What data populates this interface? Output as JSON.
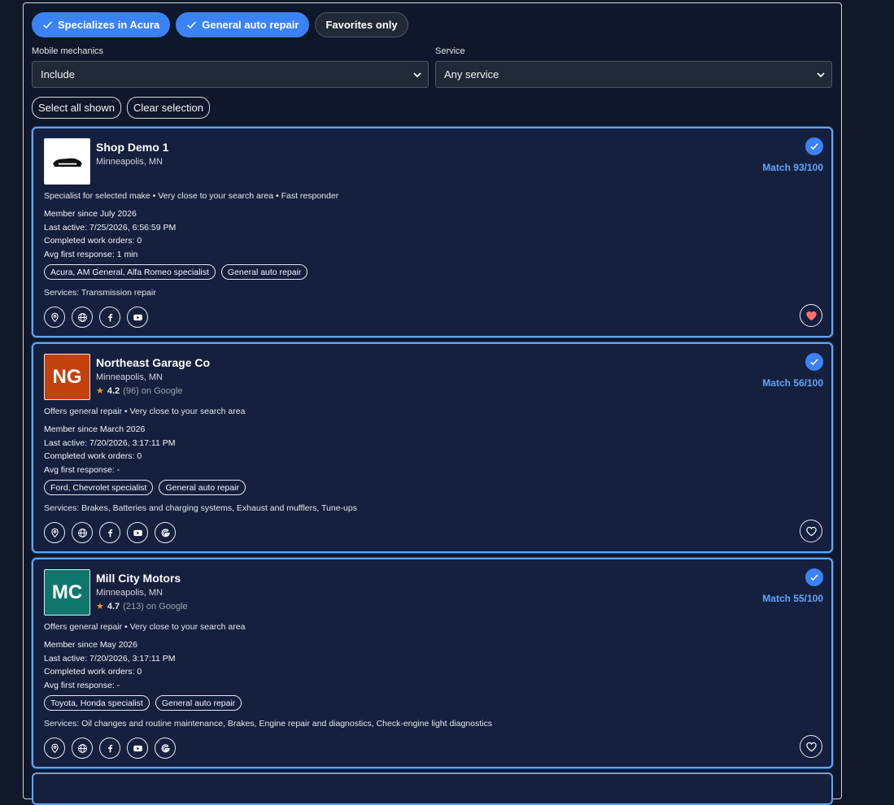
{
  "filters": {
    "chips": [
      {
        "label": "Specializes in Acura",
        "active": true
      },
      {
        "label": "General auto repair",
        "active": true
      },
      {
        "label": "Favorites only",
        "active": false
      }
    ],
    "mobile": {
      "label": "Mobile mechanics",
      "value": "Include"
    },
    "service": {
      "label": "Service",
      "value": "Any service"
    }
  },
  "actions": {
    "select_all": "Select all shown",
    "clear": "Clear selection"
  },
  "shops": [
    {
      "name": "Shop Demo 1",
      "location": "Minneapolis, MN",
      "logo_type": "image",
      "initials": "",
      "logo_color": "#ffffff",
      "match": "Match 93/100",
      "reasons": "Specialist for selected make • Very close to your search area • Fast responder",
      "member_since": "Member since July 2026",
      "last_active": "Last active: 7/25/2026, 6:56:59 PM",
      "work_orders": "Completed work orders: 0",
      "first_response": "Avg first response: 1 min",
      "tags": [
        "Acura, AM General, Alfa Romeo specialist",
        "General auto repair"
      ],
      "services": "Services: Transmission repair",
      "favorite": true
    },
    {
      "name": "Northeast Garage Co",
      "location": "Minneapolis, MN",
      "logo_type": "initials",
      "initials": "NG",
      "logo_color": "#c2410c",
      "rating": "4.2",
      "reviews": "(96) on Google",
      "match": "Match 56/100",
      "reasons": "Offers general repair • Very close to your search area",
      "member_since": "Member since March 2026",
      "last_active": "Last active: 7/20/2026, 3:17:11 PM",
      "work_orders": "Completed work orders: 0",
      "first_response": "Avg first response: -",
      "tags": [
        "Ford, Chevrolet specialist",
        "General auto repair"
      ],
      "services": "Services: Brakes, Batteries and charging systems, Exhaust and mufflers, Tune-ups",
      "favorite": false
    },
    {
      "name": "Mill City Motors",
      "location": "Minneapolis, MN",
      "logo_type": "initials",
      "initials": "MC",
      "logo_color": "#0f766e",
      "rating": "4.7",
      "reviews": "(213) on Google",
      "match": "Match 55/100",
      "reasons": "Offers general repair • Very close to your search area",
      "member_since": "Member since May 2026",
      "last_active": "Last active: 7/20/2026, 3:17:11 PM",
      "work_orders": "Completed work orders: 0",
      "first_response": "Avg first response: -",
      "tags": [
        "Toyota, Honda specialist",
        "General auto repair"
      ],
      "services": "Services: Oil changes and routine maintenance, Brakes, Engine repair and diagnostics, Check-engine light diagnostics",
      "favorite": false
    }
  ],
  "colors": {
    "accent": "#3b82f6",
    "match": "#60a5fa",
    "favorite": "#f87171",
    "star": "#f59e0b"
  }
}
